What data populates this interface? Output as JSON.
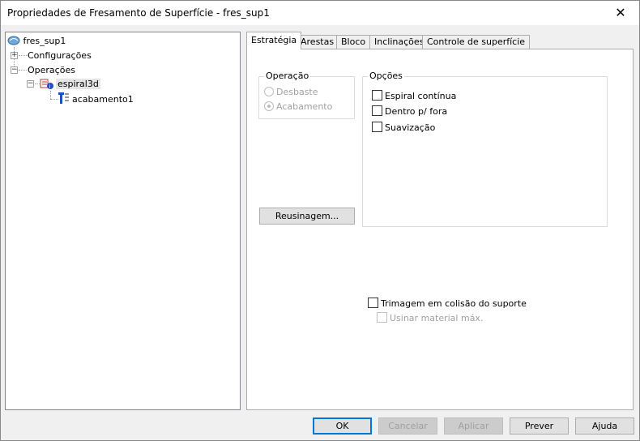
{
  "window": {
    "title": "Propriedades de Fresamento de Superfície - fres_sup1",
    "close_glyph": "✕"
  },
  "tree": {
    "root": {
      "label": "fres_sup1",
      "icon": "milling-root-icon"
    },
    "configuracoes": {
      "label": "Configurações",
      "expander": "+"
    },
    "operacoes": {
      "label": "Operações",
      "expander": "−"
    },
    "espiral3d": {
      "label": "espiral3d",
      "expander": "−",
      "icon": "spiral-operation-icon"
    },
    "acabamento": {
      "label": "acabamento1",
      "icon": "tool-icon"
    }
  },
  "tabs": [
    "Estratégia",
    "Arestas",
    "Bloco",
    "Inclinações",
    "Controle de superfície"
  ],
  "operacao": {
    "label": "Operação",
    "options": [
      {
        "label": "Desbaste",
        "checked": false
      },
      {
        "label": "Acabamento",
        "checked": true
      }
    ]
  },
  "opcoes": {
    "label": "Opções",
    "items": [
      {
        "label": "Espiral contínua",
        "checked": false
      },
      {
        "label": "Dentro p/ fora",
        "checked": false
      },
      {
        "label": "Suavização",
        "checked": false
      }
    ]
  },
  "reusinagem_label": "Reusinagem...",
  "trimagem_label": "Trimagem em colisão do suporte",
  "usinar_label": "Usinar material máx.",
  "buttons": {
    "ok": "OK",
    "cancelar": "Cancelar",
    "aplicar": "Aplicar",
    "prever": "Prever",
    "ajuda": "Ajuda"
  }
}
